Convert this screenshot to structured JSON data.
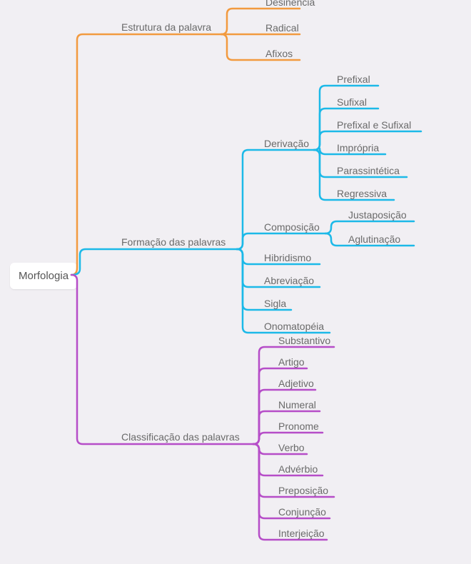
{
  "root": "Morfologia",
  "branches": {
    "b1": {
      "label": "Estrutura da palavra",
      "children": [
        "Desinência",
        "Radical",
        "Afixos"
      ]
    },
    "b2": {
      "label": "Formação das palavras",
      "children": {
        "c1": {
          "label": "Derivação",
          "children": [
            "Prefixal",
            "Sufixal",
            "Prefixal e Sufixal",
            "Imprópria",
            "Parassintética",
            "Regressiva"
          ]
        },
        "c2": {
          "label": "Composição",
          "children": [
            "Justaposição",
            "Aglutinação"
          ]
        },
        "c3": "Hibridismo",
        "c4": "Abreviação",
        "c5": "Sigla",
        "c6": "Onomatopéia"
      }
    },
    "b3": {
      "label": "Classificação das palavras",
      "children": [
        "Substantivo",
        "Artigo",
        "Adjetivo",
        "Numeral",
        "Pronome",
        "Verbo",
        "Advérbio",
        "Preposição",
        "Conjunção",
        "Interjeição"
      ]
    }
  }
}
